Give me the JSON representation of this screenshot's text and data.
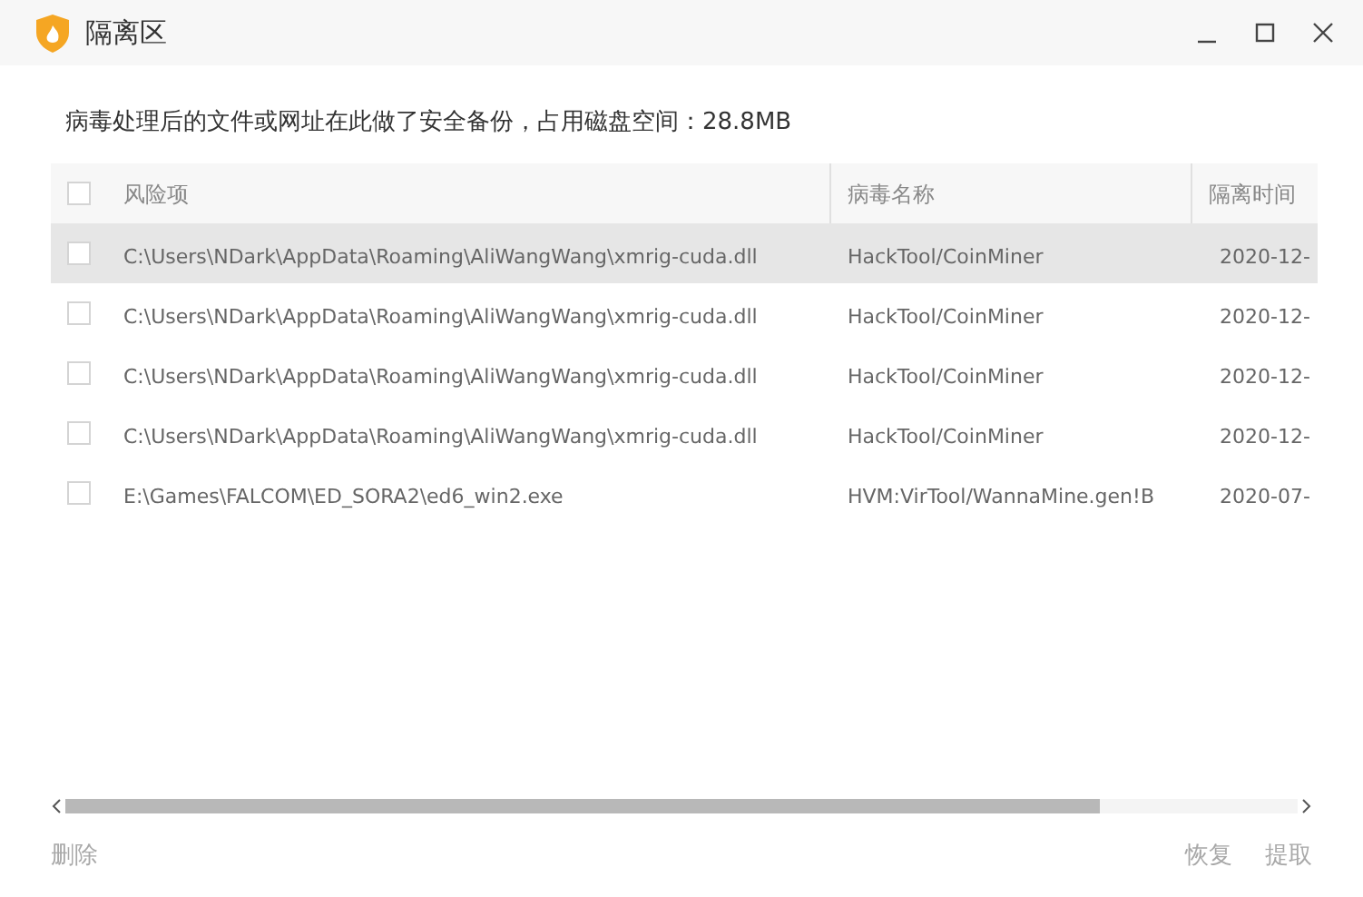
{
  "window": {
    "title": "隔离区"
  },
  "description": "病毒处理后的文件或网址在此做了安全备份，占用磁盘空间：28.8MB",
  "table": {
    "select_all": {
      "checked": false
    },
    "columns": [
      "风险项",
      "病毒名称",
      "隔离时间"
    ],
    "rows": [
      {
        "checked": false,
        "selected": true,
        "path": "C:\\Users\\NDark\\AppData\\Roaming\\AliWangWang\\xmrig-cuda.dll",
        "virus": "HackTool/CoinMiner",
        "time": "2020-12-"
      },
      {
        "checked": false,
        "selected": false,
        "path": "C:\\Users\\NDark\\AppData\\Roaming\\AliWangWang\\xmrig-cuda.dll",
        "virus": "HackTool/CoinMiner",
        "time": "2020-12-"
      },
      {
        "checked": false,
        "selected": false,
        "path": "C:\\Users\\NDark\\AppData\\Roaming\\AliWangWang\\xmrig-cuda.dll",
        "virus": "HackTool/CoinMiner",
        "time": "2020-12-"
      },
      {
        "checked": false,
        "selected": false,
        "path": "C:\\Users\\NDark\\AppData\\Roaming\\AliWangWang\\xmrig-cuda.dll",
        "virus": "HackTool/CoinMiner",
        "time": "2020-12-"
      },
      {
        "checked": false,
        "selected": false,
        "path": "E:\\Games\\FALCOM\\ED_SORA2\\ed6_win2.exe",
        "virus": "HVM:VirTool/WannaMine.gen!B",
        "time": "2020-07-"
      }
    ]
  },
  "footer": {
    "left": [
      {
        "label": "删除",
        "disabled": true
      }
    ],
    "right": [
      {
        "label": "恢复",
        "disabled": true
      },
      {
        "label": "提取",
        "disabled": true
      }
    ]
  }
}
